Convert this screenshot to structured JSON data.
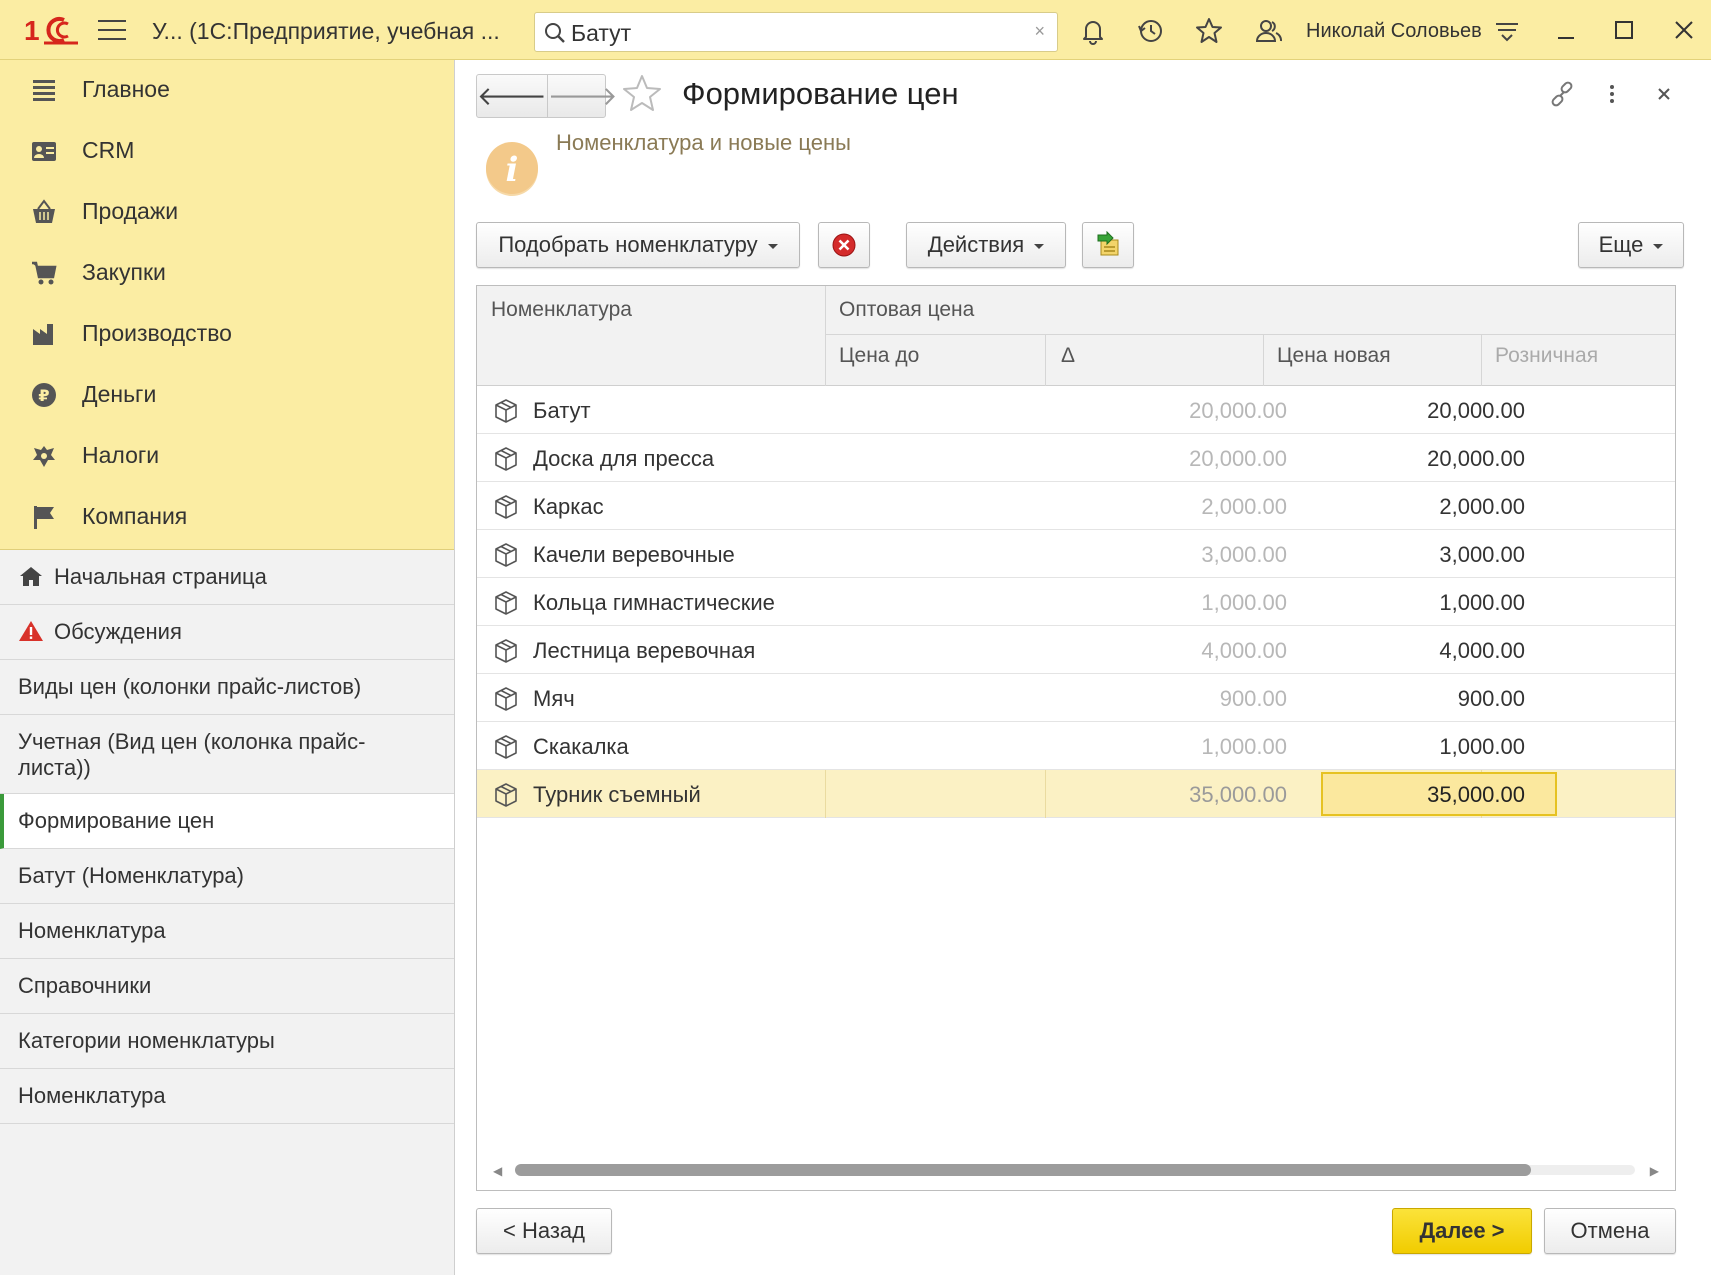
{
  "titlebar": {
    "app_title": "У... (1С:Предприятие, учебная ...",
    "search_value": "Батут",
    "search_clear": "×",
    "user_name": "Николай Соловьев"
  },
  "sections": [
    {
      "label": "Главное",
      "icon": "menu-icon"
    },
    {
      "label": "CRM",
      "icon": "contacts-icon"
    },
    {
      "label": "Продажи",
      "icon": "basket-icon"
    },
    {
      "label": "Закупки",
      "icon": "cart-icon"
    },
    {
      "label": "Производство",
      "icon": "factory-icon"
    },
    {
      "label": "Деньги",
      "icon": "ruble-icon"
    },
    {
      "label": "Налоги",
      "icon": "emblem-icon"
    },
    {
      "label": "Компания",
      "icon": "flag-icon"
    }
  ],
  "opened": [
    {
      "label": "Начальная страница",
      "icon": "home-icon"
    },
    {
      "label": "Обсуждения",
      "icon": "alert-icon"
    },
    {
      "label": "Виды цен (колонки прайс-листов)"
    },
    {
      "label": "Учетная (Вид цен (колонка прайс-листа))"
    },
    {
      "label": "Формирование цен",
      "active": true
    },
    {
      "label": "Батут (Номенклатура)"
    },
    {
      "label": "Номенклатура"
    },
    {
      "label": "Справочники"
    },
    {
      "label": "Категории номенклатуры"
    },
    {
      "label": "Номенклатура"
    }
  ],
  "form": {
    "back": "🡐",
    "forward": "🡒",
    "title": "Формирование цен",
    "info": "Номенклатура и новые цены"
  },
  "toolbar": {
    "pick": "Подобрать номенклатуру",
    "actions": "Действия",
    "more": "Еще"
  },
  "table": {
    "col_item": "Номенклатура",
    "group_wholesale": "Оптовая цена",
    "col_price_before": "Цена до",
    "col_delta": "Δ",
    "col_price_new": "Цена новая",
    "col_retail": "Розничная",
    "rows": [
      {
        "name": "Батут",
        "old": "20,000.00",
        "new": "20,000.00"
      },
      {
        "name": "Доска для пресса",
        "old": "20,000.00",
        "new": "20,000.00"
      },
      {
        "name": "Каркас",
        "old": "2,000.00",
        "new": "2,000.00"
      },
      {
        "name": "Качели веревочные",
        "old": "3,000.00",
        "new": "3,000.00"
      },
      {
        "name": "Кольца гимнастические",
        "old": "1,000.00",
        "new": "1,000.00"
      },
      {
        "name": "Лестница веревочная",
        "old": "4,000.00",
        "new": "4,000.00"
      },
      {
        "name": "Мяч",
        "old": "900.00",
        "new": "900.00"
      },
      {
        "name": "Скакалка",
        "old": "1,000.00",
        "new": "1,000.00"
      },
      {
        "name": "Турник съемный",
        "old": "35,000.00",
        "new": "35,000.00",
        "selected": true
      }
    ]
  },
  "footer": {
    "back": "< Назад",
    "next": "Далее >",
    "cancel": "Отмена"
  },
  "colors": {
    "accent_yellow": "#fbeda3",
    "primary_button": "#f1cc00",
    "active_marker": "#3a9a3a",
    "logo_red": "#d6261c"
  }
}
